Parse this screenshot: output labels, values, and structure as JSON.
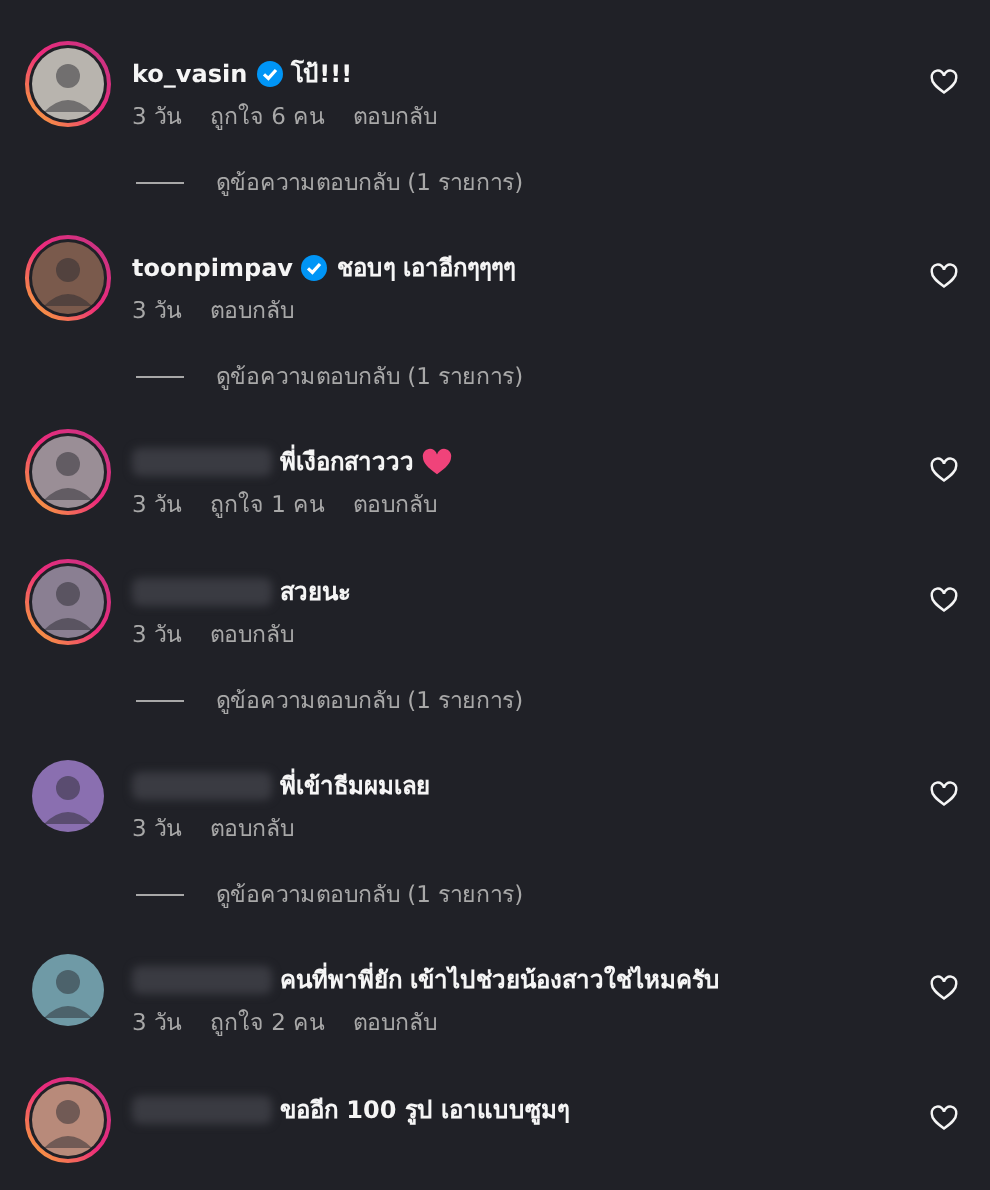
{
  "comments": [
    {
      "username": "ko_vasin",
      "username_blurred": false,
      "verified": true,
      "text": "โป้!!!",
      "trailing_heart": false,
      "story_ring": true,
      "meta": [
        "3 วัน",
        "ถูกใจ 6 คน",
        "ตอบกลับ"
      ],
      "view_replies": "ดูข้อความตอบกลับ (1 รายการ)"
    },
    {
      "username": "toonpimpav",
      "username_blurred": false,
      "verified": true,
      "text": "ชอบๆ เอาอีกๆๆๆๆ",
      "trailing_heart": false,
      "story_ring": true,
      "meta": [
        "3 วัน",
        "ตอบกลับ"
      ],
      "view_replies": "ดูข้อความตอบกลับ (1 รายการ)"
    },
    {
      "username_blurred": true,
      "verified": false,
      "text": "พี่เงือกสาววว",
      "trailing_heart": true,
      "story_ring": true,
      "meta": [
        "3 วัน",
        "ถูกใจ 1 คน",
        "ตอบกลับ"
      ]
    },
    {
      "username_blurred": true,
      "verified": false,
      "text": "สวยนะ",
      "trailing_heart": false,
      "story_ring": true,
      "meta": [
        "3 วัน",
        "ตอบกลับ"
      ],
      "view_replies": "ดูข้อความตอบกลับ (1 รายการ)"
    },
    {
      "username_blurred": true,
      "verified": false,
      "text": "พี่เข้าธีมผมเลย",
      "trailing_heart": false,
      "story_ring": false,
      "meta": [
        "3 วัน",
        "ตอบกลับ"
      ],
      "view_replies": "ดูข้อความตอบกลับ (1 รายการ)"
    },
    {
      "username_blurred": true,
      "verified": false,
      "text": "คนที่พาพี่ยัก เข้าไปช่วยน้องสาวใช่ไหมครับ",
      "trailing_heart": false,
      "story_ring": false,
      "meta": [
        "3 วัน",
        "ถูกใจ 2 คน",
        "ตอบกลับ"
      ]
    },
    {
      "username_blurred": true,
      "verified": false,
      "text": "ขออีก 100 รูป เอาแบบซูมๆ",
      "trailing_heart": false,
      "story_ring": true
    }
  ]
}
